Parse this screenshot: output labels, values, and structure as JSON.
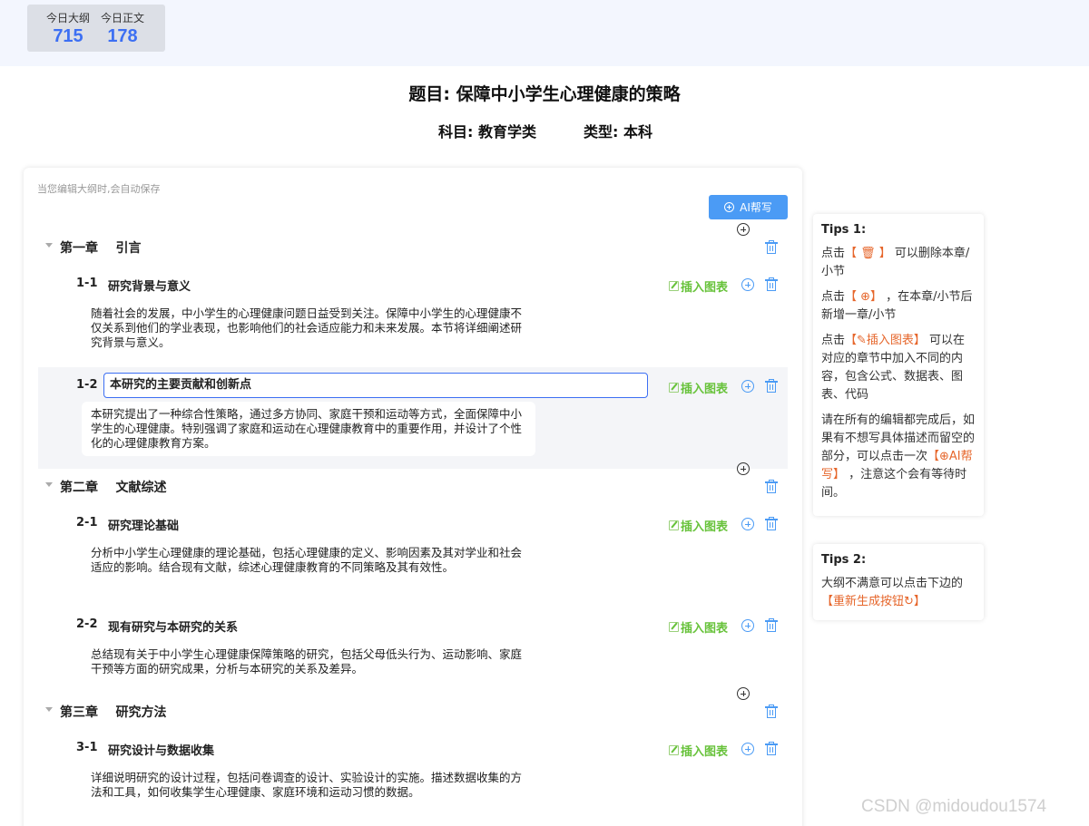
{
  "stats": {
    "outline_label": "今日大纲",
    "outline_count": "715",
    "body_label": "今日正文",
    "body_count": "178"
  },
  "header": {
    "title": "题目: 保障中小学生心理健康的策略",
    "subject": "科目: 教育学类",
    "type": "类型: 本科"
  },
  "editor": {
    "autosave_note": "当您编辑大纲时,会自动保存",
    "ai_button_label": "AI帮写",
    "insert_label": "插入图表",
    "chapters": [
      {
        "title": "第一章    引言",
        "sections": [
          {
            "num": "1-1",
            "title": "研究背景与意义",
            "body": "随着社会的发展，中小学生的心理健康问题日益受到关注。保障中小学生的心理健康不仅关系到他们的学业表现，也影响他们的社会适应能力和未来发展。本节将详细阐述研究背景与意义。"
          },
          {
            "num": "1-2",
            "title": "本研究的主要贡献和创新点",
            "body": "本研究提出了一种综合性策略，通过多方协同、家庭干预和运动等方式，全面保障中小学生的心理健康。特别强调了家庭和运动在心理健康教育中的重要作用，并设计了个性化的心理健康教育方案。"
          }
        ]
      },
      {
        "title": "第二章    文献综述",
        "sections": [
          {
            "num": "2-1",
            "title": "研究理论基础",
            "body": "分析中小学生心理健康的理论基础，包括心理健康的定义、影响因素及其对学业和社会适应的影响。结合现有文献，综述心理健康教育的不同策略及其有效性。"
          },
          {
            "num": "2-2",
            "title": "现有研究与本研究的关系",
            "body": "总结现有关于中小学生心理健康保障策略的研究，包括父母低头行为、运动影响、家庭干预等方面的研究成果，分析与本研究的关系及差异。"
          }
        ]
      },
      {
        "title": "第三章    研究方法",
        "sections": [
          {
            "num": "3-1",
            "title": "研究设计与数据收集",
            "body": "详细说明研究的设计过程，包括问卷调查的设计、实验设计的实施。描述数据收集的方法和工具，如何收集学生心理健康、家庭环境和运动习惯的数据。"
          }
        ]
      }
    ]
  },
  "tips": {
    "tip1_title": "Tips 1:",
    "tip1_p1_a": "点击",
    "tip1_p1_icon": "【 🗑 】",
    "tip1_p1_b": " 可以删除本章/小节",
    "tip1_p2_a": "点击",
    "tip1_p2_icon": "【 ⊕】",
    "tip1_p2_b": " ，在本章/小节后新增一章/小节",
    "tip1_p3_a": "点击",
    "tip1_p3_icon": "【✎插入图表】",
    "tip1_p3_b": " 可以在对应的章节中加入不同的内容，包含公式、数据表、图表、代码",
    "tip1_p4_a": "请在所有的编辑都完成后，如果有不想写具体描述而留空的部分，可以点击一次",
    "tip1_p4_icon": "【⊕AI帮写】",
    "tip1_p4_b": " ，注意这个会有等待时间。",
    "tip2_title": "Tips 2:",
    "tip2_text": "大纲不满意可以点击下边的",
    "tip2_link": "【重新生成按钮↻】"
  },
  "watermark": "CSDN @midoudou1574",
  "colors": {
    "accent": "#3c6ff3",
    "insert_green": "#67c23a",
    "tip_orange": "#e6662b",
    "topbar_bg": "#f3f6fe"
  }
}
